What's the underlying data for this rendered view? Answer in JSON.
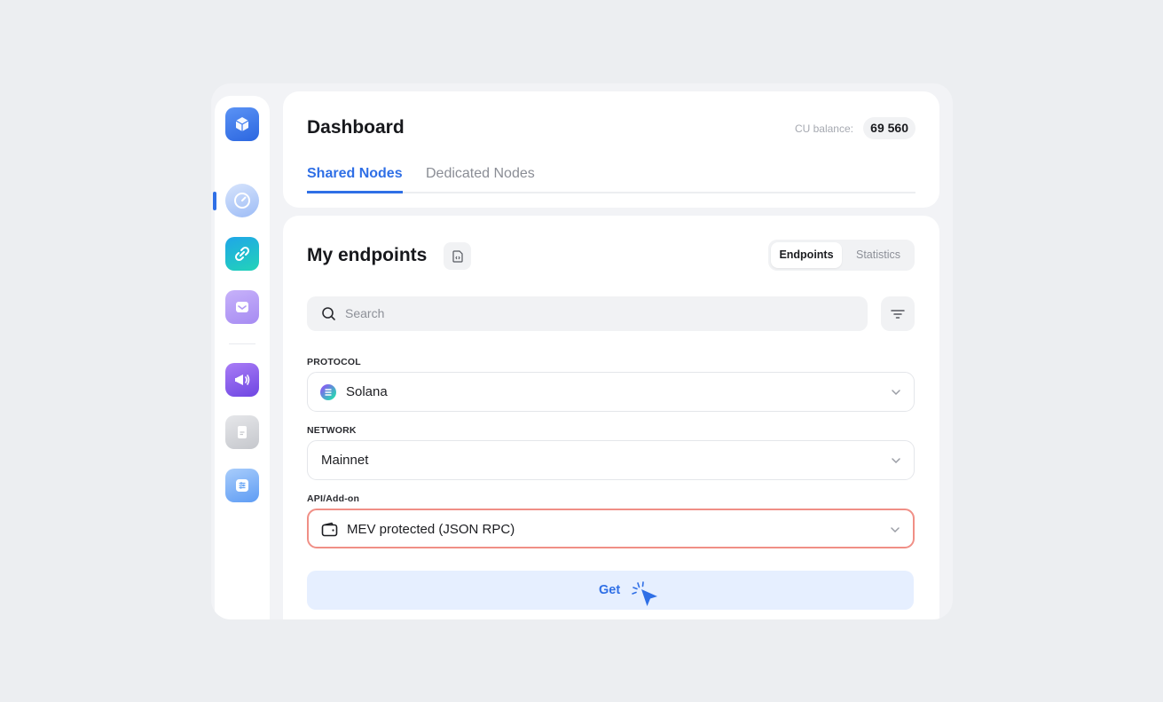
{
  "header": {
    "title": "Dashboard",
    "cu_balance_label": "CU balance:",
    "cu_balance_value": "69 560",
    "tabs": [
      {
        "label": "Shared Nodes",
        "active": true
      },
      {
        "label": "Dedicated Nodes",
        "active": false
      }
    ]
  },
  "sidebar": {
    "items": [
      {
        "icon": "cube-logo-icon",
        "color": "#3d7bf0"
      },
      {
        "icon": "gauge-icon",
        "color": "#a9c3f7",
        "active": true
      },
      {
        "icon": "link-icon",
        "color": "#19b9d8"
      },
      {
        "icon": "inbox-icon",
        "color": "#b79bf5"
      },
      {
        "icon": "megaphone-icon",
        "color": "#8a5cf0"
      },
      {
        "icon": "document-icon",
        "color": "#c9cbd0"
      },
      {
        "icon": "sliders-icon",
        "color": "#7fb3f7"
      }
    ]
  },
  "main": {
    "title": "My endpoints",
    "segments": [
      {
        "label": "Endpoints",
        "active": true
      },
      {
        "label": "Statistics",
        "active": false
      }
    ],
    "search": {
      "placeholder": "Search"
    },
    "protocol": {
      "label": "PROTOCOL",
      "value": "Solana"
    },
    "network": {
      "label": "NETWORK",
      "value": "Mainnet"
    },
    "api": {
      "label": "API/Add-on",
      "value": "MEV protected (JSON RPC)"
    },
    "get_button": "Get"
  },
  "colors": {
    "accent": "#2f6fe6",
    "focus_border": "#f08f86",
    "page_bg": "#eceef1"
  }
}
